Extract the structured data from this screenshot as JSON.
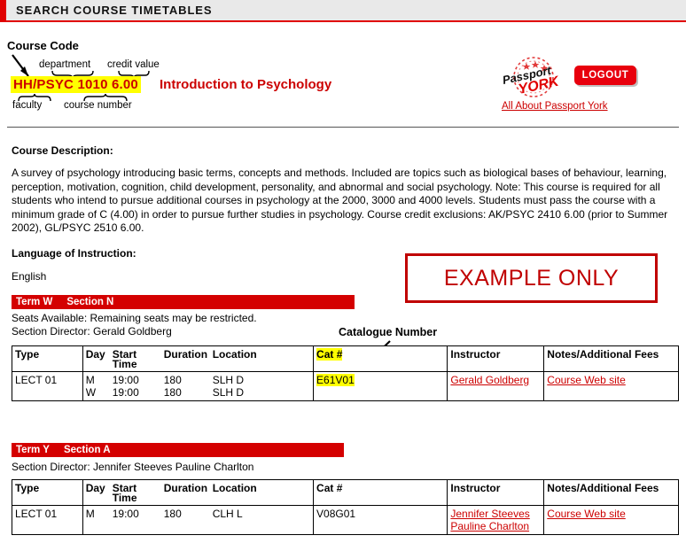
{
  "topbar": {
    "title": "SEARCH COURSE TIMETABLES",
    "accent": "#e00000",
    "background": "#e9e9e9"
  },
  "annotations": {
    "course_code": "Course Code",
    "department": "department",
    "credit_value": "credit value",
    "faculty": "faculty",
    "course_number": "course number",
    "catalogue_number": "Catalogue Number",
    "example_only": "EXAMPLE ONLY"
  },
  "course": {
    "code": "HH/PSYC 1010 6.00",
    "title": "Introduction to Psychology",
    "code_highlight": "#ffff00",
    "code_color": "#cc0000"
  },
  "passport": {
    "stamp_word_1": "Passport",
    "stamp_word_2": "YORK",
    "logout_label": "LOGOUT",
    "link": "All About Passport York"
  },
  "description": {
    "heading": "Course Description:",
    "body": "A survey of psychology introducing basic terms, concepts and methods. Included are topics such as biological bases of behaviour, learning, perception, motivation, cognition, child development, personality, and abnormal and social psychology. Note: This course is required for all students who intend to pursue additional courses in psychology at the 2000, 3000 and 4000 levels. Students must pass the course with a minimum grade of C (4.00) in order to pursue further studies in psychology. Course credit exclusions: AK/PSYC 2410 6.00 (prior to Summer 2002), GL/PSYC 2510 6.00."
  },
  "language": {
    "heading": "Language of Instruction:",
    "value": "English"
  },
  "table_headers": [
    "Type",
    "Day",
    "Start Time",
    "Duration",
    "Location",
    "Cat #",
    "Instructor",
    "Notes/Additional Fees"
  ],
  "sections": [
    {
      "term": "Term W",
      "section": "Section A_N",
      "section_label": "Section N",
      "seats": "Seats Available: Remaining seats may be restricted.",
      "director": "Section Director: Gerald Goldberg",
      "rows": [
        {
          "type": "LECT 01",
          "schedule": [
            {
              "day": "M",
              "time": "19:00",
              "duration": "180",
              "location": "SLH  D"
            },
            {
              "day": "W",
              "time": "19:00",
              "duration": "180",
              "location": "SLH  D"
            }
          ],
          "cat": "E61V01",
          "cat_highlight": true,
          "instructors": [
            "Gerald Goldberg"
          ],
          "notes": [
            "Course Web site"
          ]
        }
      ]
    },
    {
      "term": "Term Y",
      "section_label": "Section A",
      "director": "Section Director: Jennifer Steeves   Pauline Charlton",
      "rows": [
        {
          "type": "LECT 01",
          "schedule": [
            {
              "day": "M",
              "time": "19:00",
              "duration": "180",
              "location": "CLH  L"
            }
          ],
          "cat": "V08G01",
          "cat_highlight": false,
          "instructors": [
            "Jennifer Steeves",
            "Pauline Charlton"
          ],
          "notes": [
            "Course Web site"
          ]
        }
      ]
    }
  ]
}
